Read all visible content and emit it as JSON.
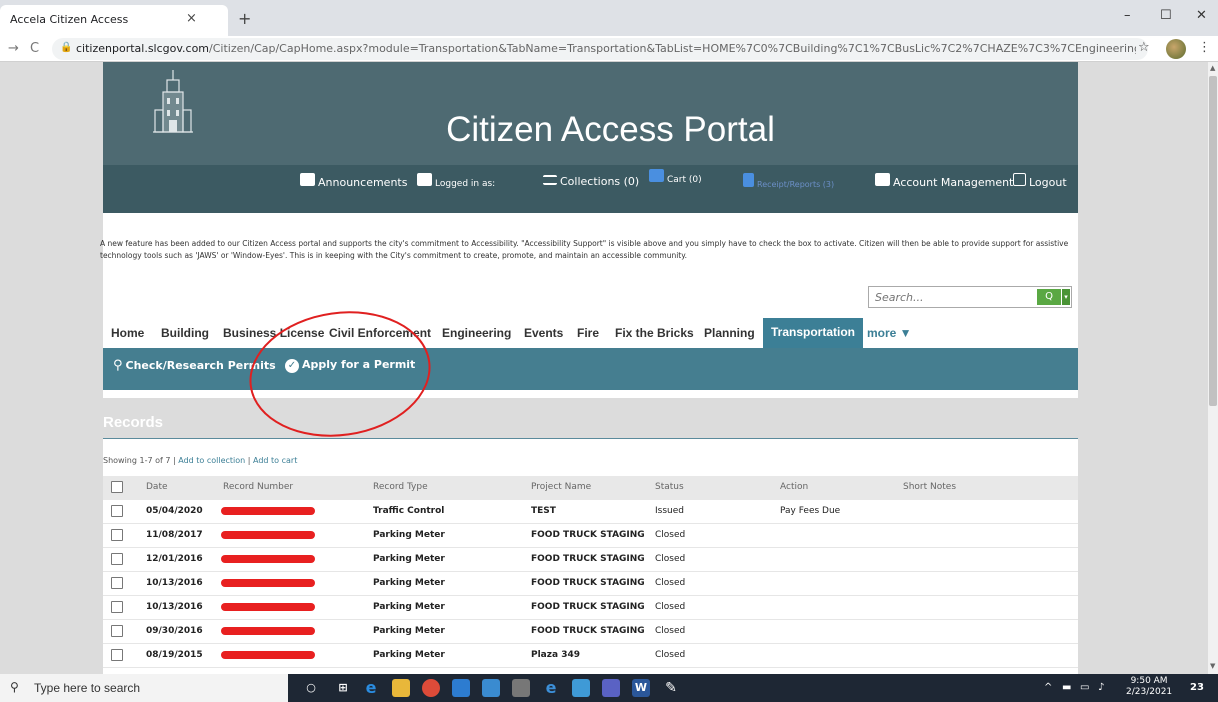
{
  "browser": {
    "tab_title": "Accela Citizen Access",
    "tab_close": "×",
    "new_tab": "+",
    "url_domain": "citizenportal.slcgov.com",
    "url_path": "/Citizen/Cap/CapHome.aspx?module=Transportation&TabName=Transportation&TabList=HOME%7C0%7CBuilding%7C1%7CBusLic%7C2%7CHAZE%7C3%7CEngineering%7C4%7CE...",
    "back": "→",
    "reload": "C",
    "lock": "🔒",
    "star": "☆",
    "kebab": "⋮",
    "min": "–",
    "max": "☐",
    "close": "✕"
  },
  "header": {
    "title": "Citizen Access Portal",
    "links": {
      "announcements": "Announcements",
      "logged_in": "Logged in as:",
      "collections": "Collections (0)",
      "cart": "Cart (0)",
      "receipts": "Receipt/Reports (3)",
      "account": "Account Management",
      "logout": "Logout"
    }
  },
  "notice": "A new feature has been added to our Citizen Access portal and supports the city's commitment to Accessibility. \"Accessibility Support\" is visible above and you simply have to check the box to activate. Citizen will then be able to provide support for assistive technology tools such as 'JAWS' or 'Window-Eyes'. This is in keeping with the City's commitment to create, promote, and maintain an accessible community.",
  "search": {
    "placeholder": "Search...",
    "button_icon": "Q",
    "drop_icon": "▾"
  },
  "tabs": [
    "Home",
    "Building",
    "Business License",
    "Civil Enforcement",
    "Engineering",
    "Events",
    "Fire",
    "Fix the Bricks",
    "Planning",
    "Transportation",
    "more ▼"
  ],
  "subnav": {
    "check": "Check/Research Permits",
    "apply": "Apply for a Permit"
  },
  "records": {
    "title": "Records",
    "showing": "Showing 1-7 of 7",
    "add_collection": "Add to collection",
    "add_cart": "Add to cart",
    "columns": [
      "Date",
      "Record Number",
      "Record Type",
      "Project Name",
      "Status",
      "Action",
      "Short Notes"
    ],
    "rows": [
      {
        "date": "05/04/2020",
        "type": "Traffic Control",
        "project": "TEST",
        "status": "Issued",
        "action": "Pay Fees Due"
      },
      {
        "date": "11/08/2017",
        "type": "Parking Meter",
        "project": "FOOD TRUCK STAGING",
        "status": "Closed",
        "action": ""
      },
      {
        "date": "12/01/2016",
        "type": "Parking Meter",
        "project": "FOOD TRUCK STAGING",
        "status": "Closed",
        "action": ""
      },
      {
        "date": "10/13/2016",
        "type": "Parking Meter",
        "project": "FOOD TRUCK STAGING",
        "status": "Closed",
        "action": ""
      },
      {
        "date": "10/13/2016",
        "type": "Parking Meter",
        "project": "FOOD TRUCK STAGING",
        "status": "Closed",
        "action": ""
      },
      {
        "date": "09/30/2016",
        "type": "Parking Meter",
        "project": "FOOD TRUCK STAGING",
        "status": "Closed",
        "action": ""
      },
      {
        "date": "08/19/2015",
        "type": "Parking Meter",
        "project": "Plaza 349",
        "status": "Closed",
        "action": ""
      }
    ]
  },
  "taskbar": {
    "search_text": "Type here to search",
    "time": "9:50 AM",
    "date": "2/23/2021",
    "notif": "23"
  },
  "colors": {
    "header": "#4e6a72",
    "subbar": "#457e90",
    "active_tab": "#3c7f96",
    "action_red": "#e02020",
    "search_green": "#5aa843"
  }
}
